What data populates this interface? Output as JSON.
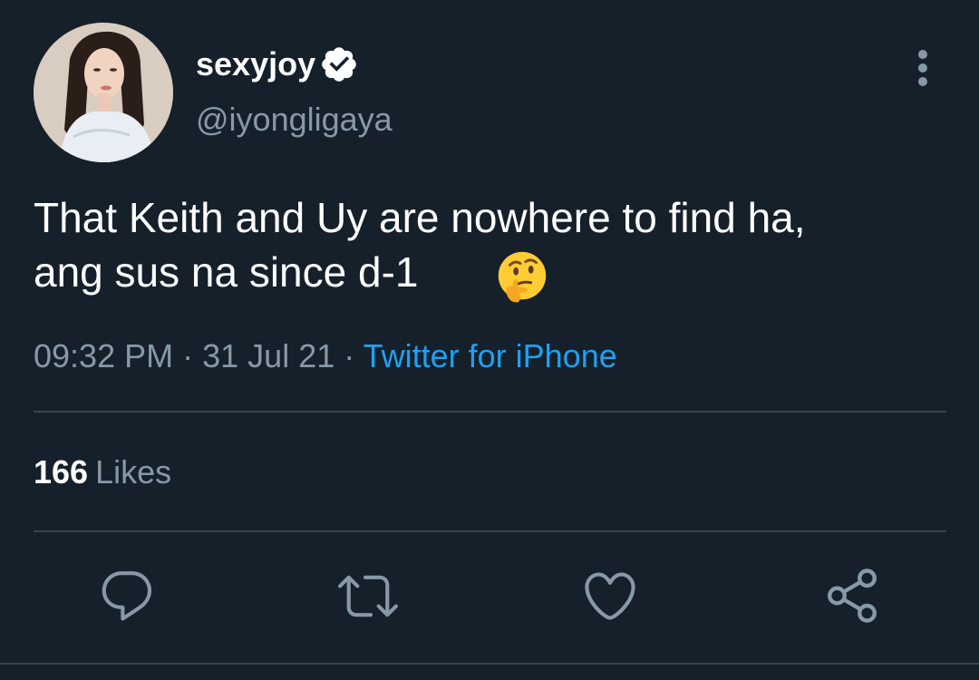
{
  "user": {
    "display_name": "sexyjoy",
    "handle": "@iyongligaya",
    "verified": true
  },
  "tweet": {
    "text_line1": "That Keith and Uy are nowhere to find ha,",
    "text_line2": "ang sus na since d-1",
    "emoji": "thinking-face"
  },
  "meta": {
    "time": "09:32 PM",
    "separator": "·",
    "date": "31 Jul 21",
    "source": "Twitter for iPhone"
  },
  "stats": {
    "likes_count": "166",
    "likes_label": "Likes"
  },
  "actions": {
    "icons": [
      "reply-icon",
      "retweet-icon",
      "like-icon",
      "share-icon"
    ]
  },
  "colors": {
    "background": "#15202b",
    "primary_text": "#ffffff",
    "secondary_text": "#8899a6",
    "accent": "#1da1f2",
    "divider": "#38444d"
  }
}
